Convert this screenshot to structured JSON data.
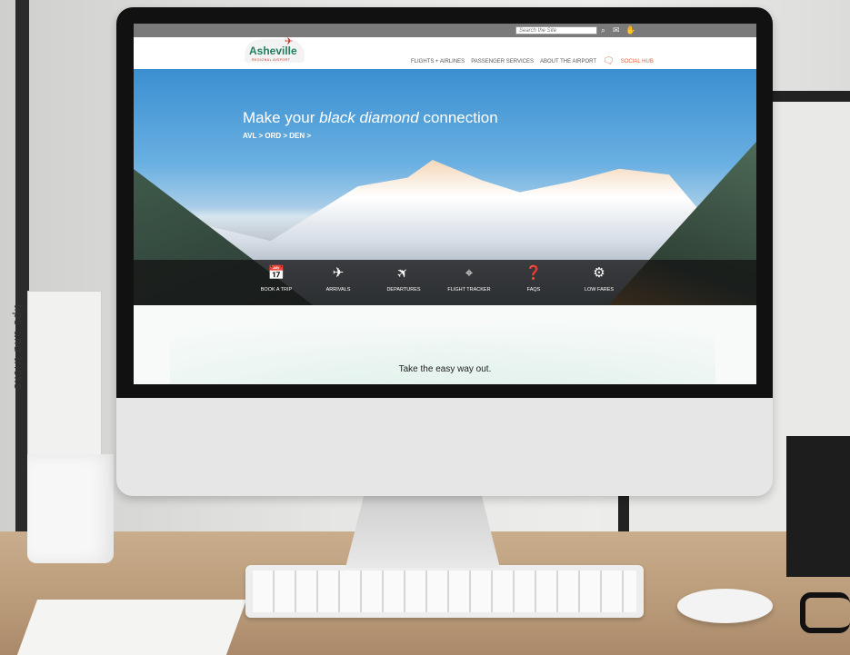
{
  "site": {
    "top_bar": {
      "search_placeholder": "Search the Site",
      "icons": [
        "search-icon",
        "mail-icon",
        "hand-icon"
      ]
    },
    "logo": {
      "name": "Asheville",
      "subtitle": "REGIONAL AIRPORT"
    },
    "nav": {
      "items": [
        "FLIGHTS + AIRLINES",
        "PASSENGER SERVICES",
        "ABOUT THE AIRPORT",
        "SOCIAL HUB"
      ]
    },
    "hero": {
      "title_pre": "Make your ",
      "title_emph": "black diamond",
      "title_post": " connection",
      "subtitle": "AVL > ORD > DEN >"
    },
    "quick_links": [
      {
        "label": "BOOK A TRIP",
        "icon": "calendar-icon"
      },
      {
        "label": "ARRIVALS",
        "icon": "plane-arriving-icon"
      },
      {
        "label": "DEPARTURES",
        "icon": "plane-departing-icon"
      },
      {
        "label": "FLIGHT TRACKER",
        "icon": "map-pin-icon"
      },
      {
        "label": "FAQS",
        "icon": "question-icon"
      },
      {
        "label": "LOW FARES",
        "icon": "badge-icon"
      }
    ],
    "tagline": "Take the easy way out."
  },
  "scene": {
    "book_spine_text": "tips and tricks"
  },
  "colors": {
    "brand_green": "#1f7f5c",
    "brand_red": "#c0392b",
    "social_orange": "#e2603a"
  }
}
